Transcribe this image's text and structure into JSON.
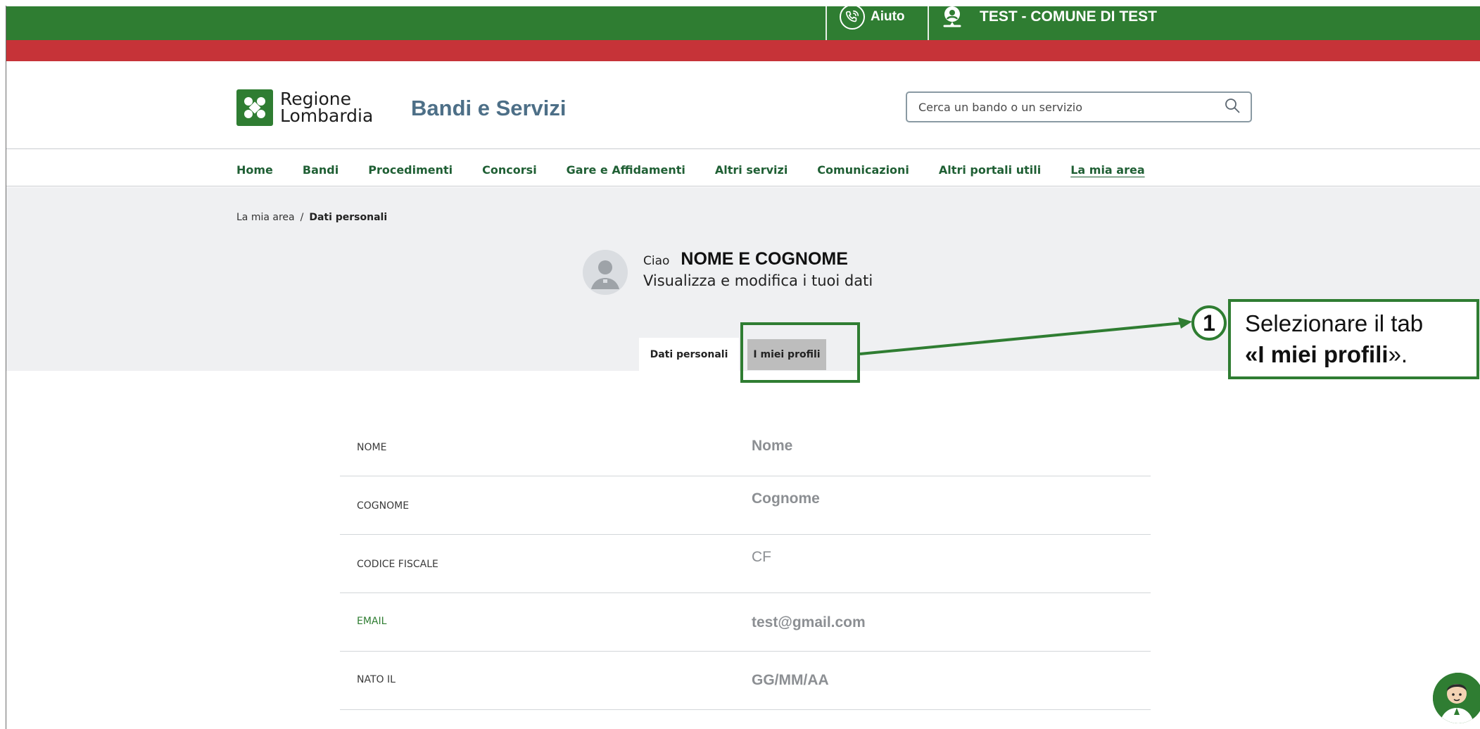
{
  "topbar": {
    "help_label": "Aiuto",
    "user_label": "TEST - COMUNE DI TEST",
    "help_icon": "phone-help-icon",
    "user_icon": "user-location-icon"
  },
  "header": {
    "logo_line1": "Regione",
    "logo_line2": "Lombardia",
    "site_title": "Bandi e Servizi",
    "search_placeholder": "Cerca un bando o un servizio"
  },
  "nav": {
    "items": [
      {
        "label": "Home"
      },
      {
        "label": "Bandi"
      },
      {
        "label": "Procedimenti"
      },
      {
        "label": "Concorsi"
      },
      {
        "label": "Gare e Affidamenti"
      },
      {
        "label": "Altri servizi"
      },
      {
        "label": "Comunicazioni"
      },
      {
        "label": "Altri portali utili"
      },
      {
        "label": "La mia area",
        "active": true
      }
    ]
  },
  "breadcrumb": {
    "parent": "La mia area",
    "separator": "/",
    "current": "Dati personali"
  },
  "profile": {
    "greeting": "Ciao",
    "name": "NOME E COGNOME",
    "subtitle": "Visualizza e modifica i tuoi dati"
  },
  "tabs": [
    {
      "label": "Dati personali",
      "selected": true
    },
    {
      "label": "I miei profili",
      "selected": false
    }
  ],
  "annotation": {
    "number": "1",
    "text_before": "Selezionare il tab",
    "quote_open": "«",
    "bold": "I miei profili",
    "quote_close": "».",
    "color": "#2f7d32"
  },
  "fields": [
    {
      "label": "NOME",
      "value": "Nome"
    },
    {
      "label": "COGNOME",
      "value": "Cognome"
    },
    {
      "label": "CODICE FISCALE",
      "value": "CF"
    },
    {
      "label": "EMAIL",
      "value": "test@gmail.com"
    },
    {
      "label": "NATO IL",
      "value": "GG/MM/AA"
    }
  ],
  "colors": {
    "green": "#2f7d32",
    "red": "#c63338",
    "title_blue": "#4d6f87"
  }
}
